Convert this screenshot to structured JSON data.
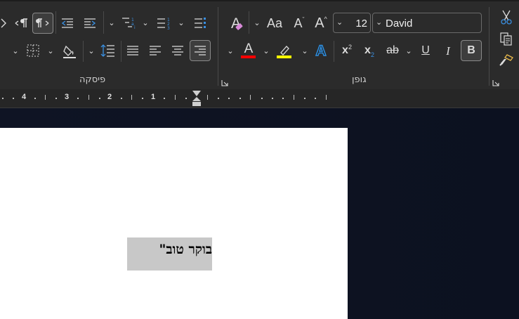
{
  "ribbon": {
    "paragraph_group_label": "פיסקה",
    "font_group_label": "גופן",
    "font_size": "12",
    "font_name": "David",
    "icons": [
      "show-marks-icon",
      "rtl-direction-icon",
      "ltr-direction-icon",
      "decrease-indent-icon",
      "increase-indent-icon",
      "multilevel-list-icon",
      "numbered-list-icon",
      "bulleted-list-icon",
      "clear-formatting-icon",
      "change-case-icon",
      "grow-font-icon",
      "shrink-font-icon",
      "cut-icon",
      "copy-icon",
      "format-painter-icon",
      "borders-icon",
      "shading-icon",
      "line-spacing-icon",
      "justify-icon",
      "align-left-icon",
      "center-icon",
      "align-right-icon",
      "font-color-icon",
      "highlight-icon",
      "text-effects-icon",
      "superscript-icon",
      "subscript-icon",
      "strikethrough-icon",
      "underline-icon",
      "italic-icon",
      "bold-icon"
    ],
    "labels": {
      "change_case": "Aa",
      "grow_font": "A",
      "shrink_font": "A",
      "clear_formatting": "A",
      "superscript": "x",
      "subscript": "x",
      "strikethrough": "ab",
      "underline": "U",
      "italic": "I",
      "bold": "B",
      "font_color": "A",
      "highlight": "ab",
      "text_effects": "A"
    },
    "colors": {
      "font_color_bar": "#ff0000",
      "highlight_bar": "#ffff00",
      "text_effects": "#2f8fe0"
    }
  },
  "ruler": {
    "numbers": [
      "4",
      "3",
      "2",
      "1"
    ]
  },
  "document": {
    "selected_text": "בוקר טוב\""
  }
}
